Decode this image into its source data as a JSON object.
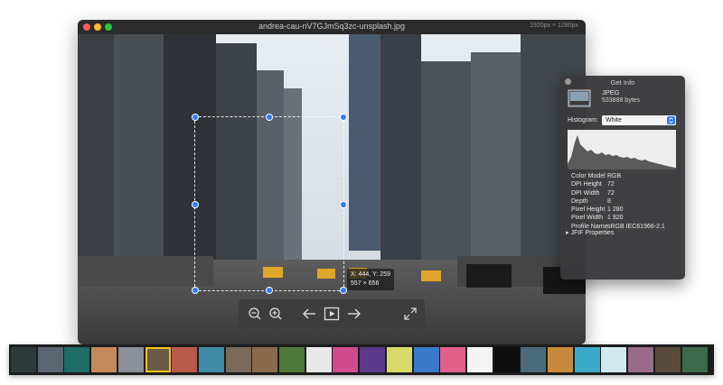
{
  "window": {
    "title": "andrea-cau-nV7GJmSq3zc-unsplash.jpg",
    "dimensions": "1920px × 1280px"
  },
  "canvas": {
    "coordinate_readout": "X: 444, Y: 259",
    "selection_size": "557 × 656"
  },
  "toolbar": {
    "buttons": [
      {
        "name": "zoom-out",
        "icon": "zoom-out-icon"
      },
      {
        "name": "zoom-in",
        "icon": "zoom-in-icon"
      },
      {
        "name": "previous",
        "icon": "arrow-left-icon"
      },
      {
        "name": "slideshow",
        "icon": "play-icon"
      },
      {
        "name": "next",
        "icon": "arrow-right-icon"
      },
      {
        "name": "fullscreen",
        "icon": "expand-icon"
      }
    ]
  },
  "info_panel": {
    "title": "Get Info",
    "file_type": "JPEG",
    "file_size": "533888 bytes",
    "histogram_label": "Histogram:",
    "histogram_mode": "White",
    "properties": [
      {
        "label": "Color Model",
        "value": "RGB"
      },
      {
        "label": "DPI Height",
        "value": "72"
      },
      {
        "label": "DPI Width",
        "value": "72"
      },
      {
        "label": "Depth",
        "value": "8"
      },
      {
        "label": "Pixel Height",
        "value": "1 280"
      },
      {
        "label": "Pixel Width",
        "value": "1 920"
      },
      {
        "label": "Profile Name",
        "value": "sRGB IEC61966-2.1"
      }
    ],
    "jfif_label": "JFIF Properties"
  },
  "thumbnails": {
    "selected_index": 5,
    "colors": [
      "#2c3a3a",
      "#5b6470",
      "#1f6d66",
      "#c58a5a",
      "#8a8f98",
      "#6b5a45",
      "#b85a4a",
      "#3f8aa7",
      "#7a6a5a",
      "#8a6a4a",
      "#4e7a3a",
      "#e8e8e8",
      "#d14a8c",
      "#5a3a8a",
      "#d9d96a",
      "#3a7ac8",
      "#e0608a",
      "#f4f4f4",
      "#0e0e0e",
      "#4a6a7a",
      "#c88a3a",
      "#3aa8c8",
      "#d4e8f0",
      "#9a6a8a",
      "#5a4a3a",
      "#3a6a4a"
    ]
  },
  "colors": {
    "accent": "#2f7bf6",
    "selection_border": "#f2c518"
  }
}
